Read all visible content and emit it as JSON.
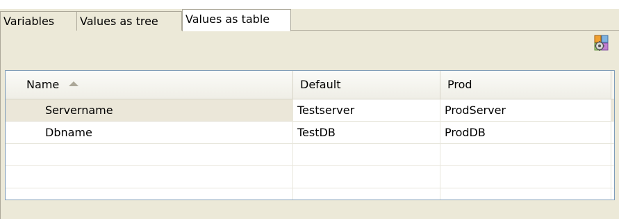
{
  "tabs": [
    {
      "label": "Variables",
      "active": false
    },
    {
      "label": "Values as tree",
      "active": false
    },
    {
      "label": "Values as table",
      "active": true
    }
  ],
  "toolbar": {
    "icon": "settings-gear-icon"
  },
  "table": {
    "columns": [
      {
        "label": "Name",
        "sorted": "ascending"
      },
      {
        "label": "Default"
      },
      {
        "label": "Prod"
      }
    ],
    "rows": [
      {
        "name": "Servername",
        "default": "Testserver",
        "prod": "ProdServer",
        "selected": true
      },
      {
        "name": "Dbname",
        "default": "TestDB",
        "prod": "ProdDB",
        "selected": false
      }
    ],
    "empty_rows": 3
  },
  "colors": {
    "chrome": "#ece9d8",
    "border": "#aca899",
    "table_border": "#7f9db9",
    "selected_row": "#ebe7d9"
  }
}
